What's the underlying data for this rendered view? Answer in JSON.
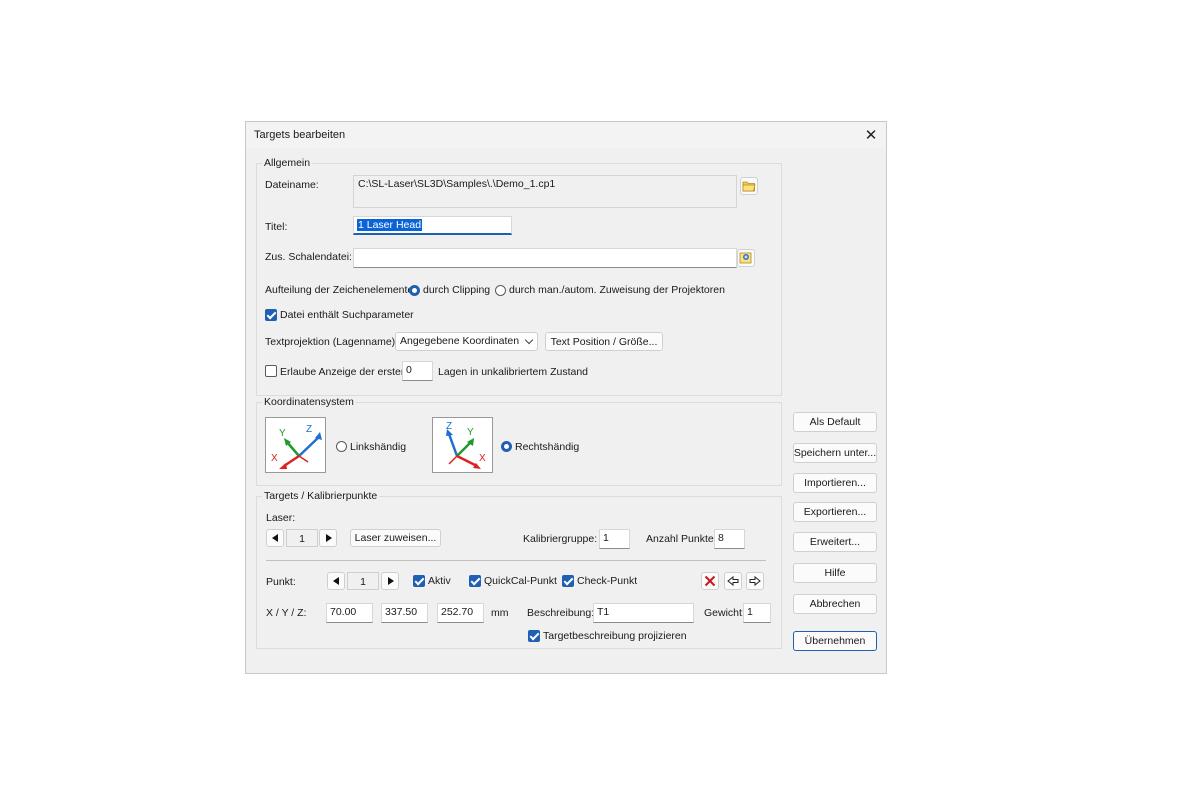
{
  "dialog": {
    "title": "Targets bearbeiten",
    "close_glyph": "✕"
  },
  "allgemein": {
    "group_label": "Allgemein",
    "dateiname_label": "Dateiname:",
    "dateiname_value": "C:\\SL-Laser\\SL3D\\Samples\\.\\Demo_1.cp1",
    "titel_label": "Titel:",
    "titel_value": "1 Laser Head",
    "schalendatei_label": "Zus. Schalendatei:",
    "schalendatei_value": "",
    "aufteilung_label": "Aufteilung der Zeichenelemente:",
    "radio_clipping": "durch Clipping",
    "radio_zuweisung": "durch man./autom. Zuweisung der Projektoren",
    "aufteilung_selected": "clipping",
    "suchparameter_label": "Datei enthält Suchparameter",
    "suchparameter_checked": true,
    "textprojektion_label": "Textprojektion (Lagenname):",
    "textprojektion_value": "Angegebene Koordinaten",
    "text_position_button": "Text Position / Größe...",
    "erlaube_label": "Erlaube Anzeige der ersten",
    "erlaube_checked": false,
    "erlaube_value": "0",
    "lagen_label": "Lagen in unkalibriertem Zustand"
  },
  "koordinaten": {
    "group_label": "Koordinatensystem",
    "links_label": "Linkshändig",
    "rechts_label": "Rechtshändig",
    "selected": "rechts",
    "axis_x": "X",
    "axis_y": "Y",
    "axis_z": "Z"
  },
  "targets": {
    "group_label": "Targets / Kalibrierpunkte",
    "laser_label": "Laser:",
    "laser_value": "1",
    "laser_zuweisen_button": "Laser zuweisen...",
    "kalibriergruppe_label": "Kalibriergruppe:",
    "kalibriergruppe_value": "1",
    "anzahl_label": "Anzahl Punkte:",
    "anzahl_value": "8",
    "punkt_label": "Punkt:",
    "punkt_value": "1",
    "aktiv_label": "Aktiv",
    "aktiv_checked": true,
    "quickcal_label": "QuickCal-Punkt",
    "quickcal_checked": true,
    "check_label": "Check-Punkt",
    "check_checked": true,
    "xyz_label": "X / Y / Z:",
    "x_value": "70.00",
    "y_value": "337.50",
    "z_value": "252.70",
    "unit": "mm",
    "beschreibung_label": "Beschreibung:",
    "beschreibung_value": "T1",
    "gewicht_label": "Gewicht:",
    "gewicht_value": "1",
    "projizieren_label": "Targetbeschreibung projizieren",
    "projizieren_checked": true
  },
  "side_buttons": {
    "als_default": "Als Default",
    "speichern_unter": "Speichern unter...",
    "importieren": "Importieren...",
    "exportieren": "Exportieren...",
    "erweitert": "Erweitert...",
    "hilfe": "Hilfe",
    "abbrechen": "Abbrechen",
    "uebernehmen": "Übernehmen"
  },
  "colors": {
    "accent": "#1f5fb4",
    "axis_red": "#e02020",
    "axis_green": "#1e9a2a",
    "axis_blue": "#1f6fd0",
    "delete_red": "#c81818"
  }
}
